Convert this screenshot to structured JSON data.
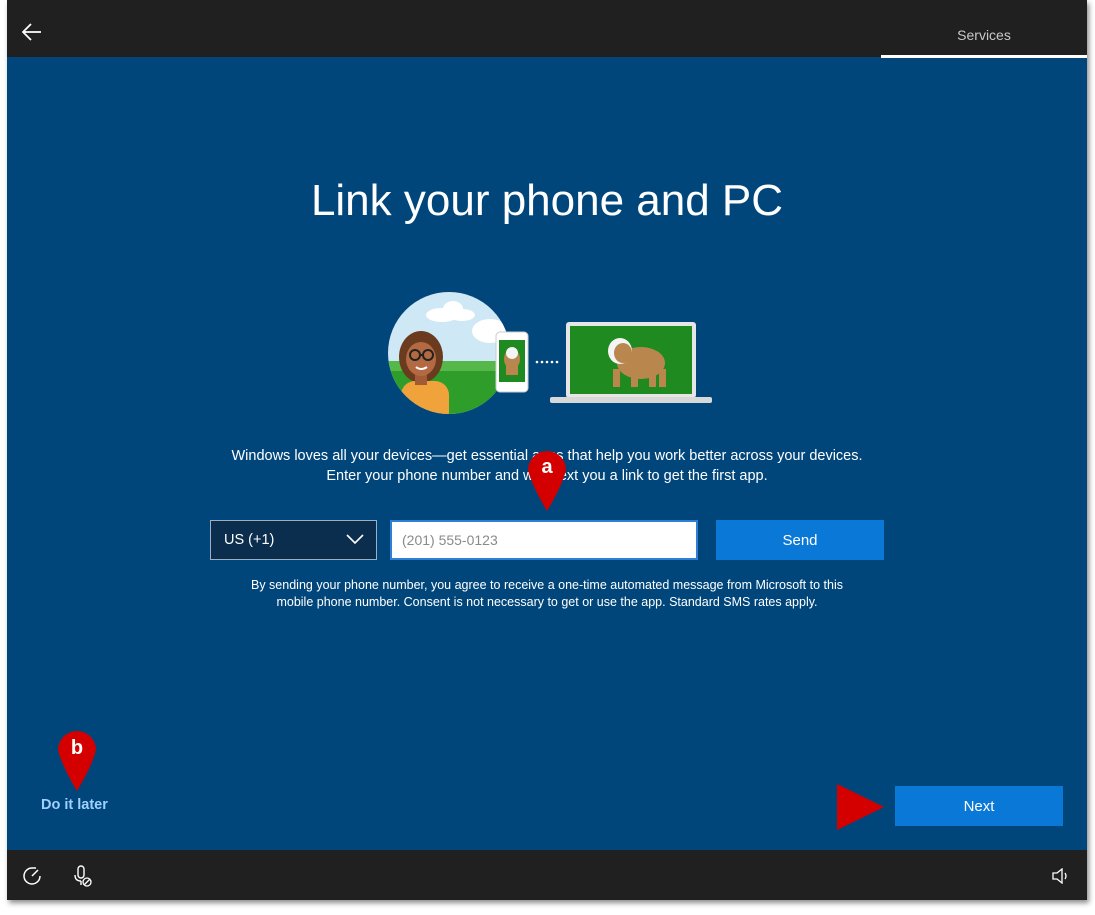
{
  "header": {
    "tab_label": "Services"
  },
  "main": {
    "title": "Link your phone and PC",
    "description_line1": "Windows loves all your devices—get essential apps that help you work better across your devices.",
    "description_line2": "Enter your phone number and we'll text you a link to get the first app.",
    "country_code": "US (+1)",
    "phone_placeholder": "(201) 555-0123",
    "send_label": "Send",
    "consent_line1": "By sending your phone number, you agree to receive a one-time automated message from Microsoft to this",
    "consent_line2": "mobile phone number. Consent is not necessary to get or use the app. Standard SMS rates apply."
  },
  "footer": {
    "do_it_later": "Do it later",
    "next_label": "Next"
  },
  "annotations": {
    "marker_a": "a",
    "marker_b": "b"
  },
  "icons": {
    "back": "back-arrow-icon",
    "chevron": "chevron-down-icon",
    "ease_of_access": "ease-of-access-icon",
    "microphone": "microphone-off-icon",
    "volume": "volume-icon"
  },
  "colors": {
    "background": "#01467b",
    "bar": "#202020",
    "button": "#0a78d7",
    "link": "#9fd0ff",
    "marker": "#d40000"
  }
}
